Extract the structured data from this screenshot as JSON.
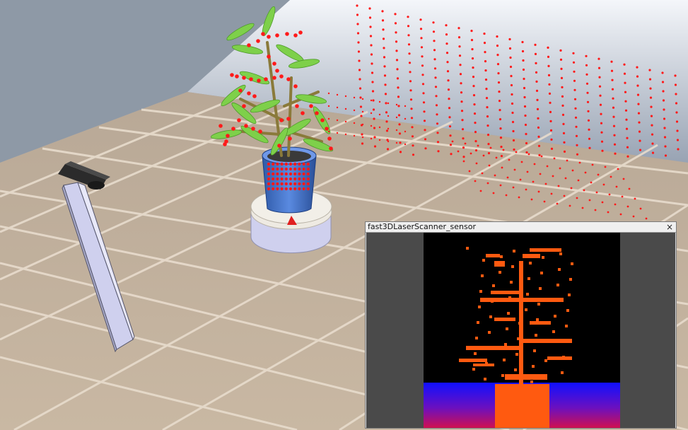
{
  "sensor_window": {
    "title": "fast3DLaserScanner_sensor",
    "close_glyph": "×",
    "close_icon": "close-icon"
  },
  "scene": {
    "objects": [
      "tiled-floor",
      "back-wall",
      "potted-plant",
      "turntable",
      "laser-scanner",
      "scanner-stand",
      "laser-point-cloud"
    ]
  },
  "colors": {
    "laser_points": "#ff1a1a",
    "floor_tile": "#cdbca8",
    "wall": "#a8b3c2",
    "pot": "#3f6fc4",
    "stand": "#cfd0ee",
    "scanner": "#2b2b2b",
    "depth_background": "#000000",
    "depth_foreground": "#ff5a10",
    "depth_floor_near": "#c01060",
    "depth_floor_far": "#1010ff"
  }
}
